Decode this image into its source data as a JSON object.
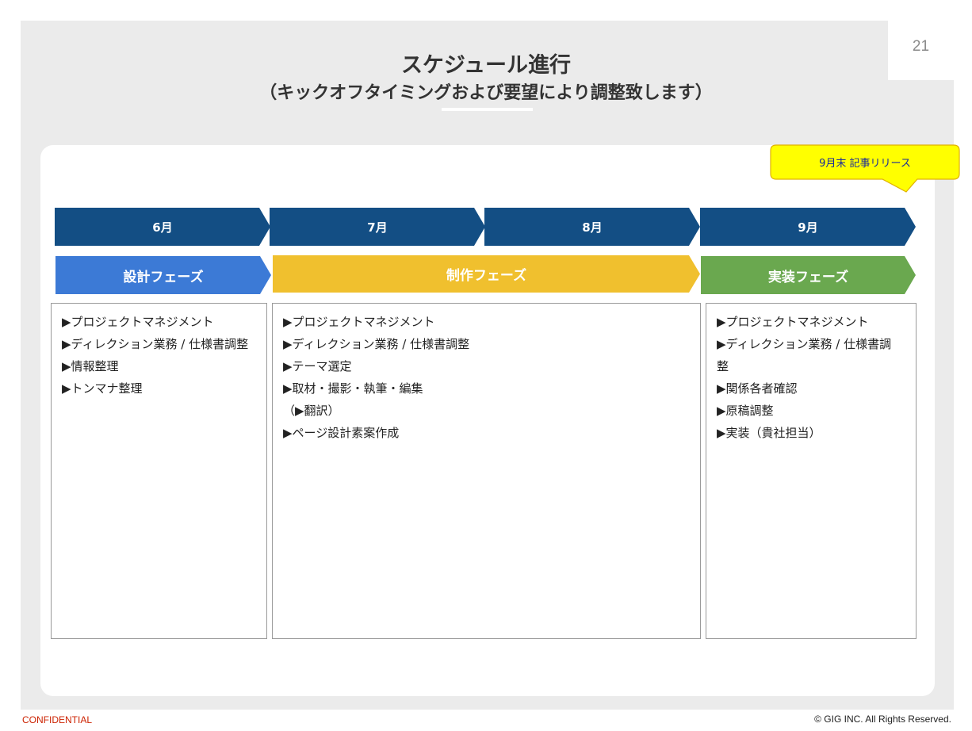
{
  "slide": {
    "page_number": "21",
    "title": "スケジュール進行",
    "subtitle": "（キックオフタイミングおよび要望により調整致します）"
  },
  "callout": {
    "text": "9月末 記事リリース",
    "fill_color": "#ffff00",
    "border_color": "#e0b000"
  },
  "months": [
    {
      "label": "6月"
    },
    {
      "label": "7月"
    },
    {
      "label": "8月"
    },
    {
      "label": "9月"
    }
  ],
  "colors": {
    "month_arrow": "#134e84",
    "design_phase": "#3c7ad6",
    "production_phase": "#f0c02e",
    "implementation_phase": "#6aa84f"
  },
  "phases": [
    {
      "label": "設計フェーズ",
      "tasks": [
        "▶プロジェクトマネジメント",
        "▶ディレクション業務 / 仕様書調整",
        "▶情報整理",
        "▶トンマナ整理"
      ]
    },
    {
      "label": "制作フェーズ",
      "tasks": [
        "▶プロジェクトマネジメント",
        "▶ディレクション業務 / 仕様書調整",
        "▶テーマ選定",
        "▶取材・撮影・執筆・編集",
        "（▶翻訳）",
        "▶ページ設計素案作成"
      ]
    },
    {
      "label": "実装フェーズ",
      "tasks": [
        "▶プロジェクトマネジメント",
        "▶ディレクション業務 / 仕様書調",
        "整",
        "▶関係各者確認",
        "▶原稿調整",
        "▶実装（貴社担当）"
      ]
    }
  ],
  "footer": {
    "confidential": "CONFIDENTIAL",
    "copyright": "© GIG INC. All Rights Reserved."
  }
}
